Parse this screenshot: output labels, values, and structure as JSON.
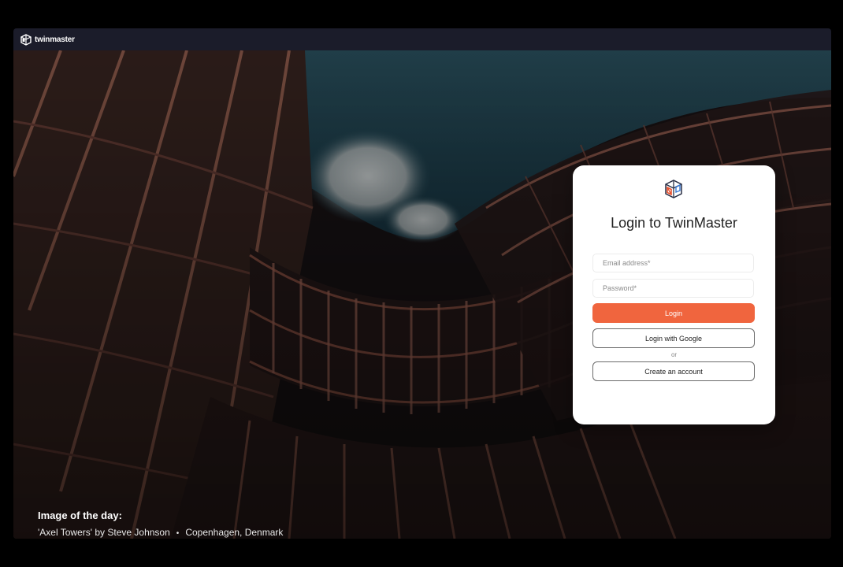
{
  "app": {
    "brand_name": "twinmaster"
  },
  "hero": {
    "image_caption_heading": "Image of the day:",
    "image_title_credit": "'Axel Towers' by Steve Johnson",
    "separator": "•",
    "location": "Copenhagen, Denmark"
  },
  "login": {
    "title": "Login to TwinMaster",
    "email_placeholder": "Email address*",
    "password_placeholder": "Password*",
    "login_label": "Login",
    "google_label": "Login with Google",
    "or_label": "or",
    "create_account_label": "Create an account"
  },
  "colors": {
    "accent": "#f0653e",
    "topbar": "#1b1c2a",
    "card": "#ffffff"
  },
  "icons": {
    "brand": "twinmaster-cube-logo",
    "card": "twinmaster-cube-logo"
  }
}
